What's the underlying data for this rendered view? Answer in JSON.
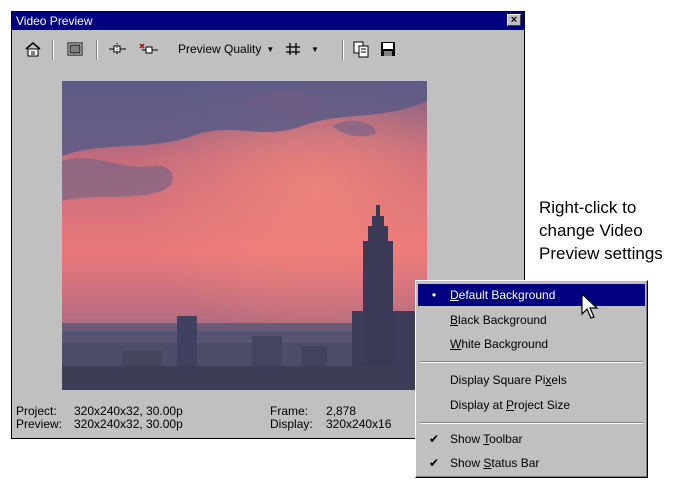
{
  "window": {
    "title": "Video Preview",
    "close_glyph": "×"
  },
  "toolbar": {
    "buttons": [
      {
        "icon": "properties-icon"
      },
      {
        "icon": "preview-window-icon"
      },
      {
        "icon": "split-screen-icon"
      },
      {
        "icon": "split-select-icon"
      }
    ],
    "preview_quality_label": "Preview Quality",
    "overlay_icon": "grid-hash-icon",
    "copy_icon": "copy-snapshot-icon",
    "save_icon": "save-snapshot-icon"
  },
  "status": {
    "project_label": "Project:",
    "project_value": "320x240x32, 30.00p",
    "preview_label": "Preview:",
    "preview_value": "320x240x32, 30.00p",
    "frame_label": "Frame:",
    "frame_value": "2,878",
    "display_label": "Display:",
    "display_value": "320x240x16"
  },
  "context_menu": {
    "items": [
      {
        "ul": "D",
        "rest": "efault Background",
        "mark": "•",
        "highlighted": true
      },
      {
        "ul": "B",
        "rest": "lack Background",
        "mark": ""
      },
      {
        "ul": "W",
        "rest": "hite Background",
        "mark": ""
      },
      {
        "pre": "Display Square Pi",
        "ul": "x",
        "rest": "els",
        "mark": ""
      },
      {
        "pre": "Display at ",
        "ul": "P",
        "rest": "roject Size",
        "mark": ""
      },
      {
        "pre": "Show ",
        "ul": "T",
        "rest": "oolbar",
        "mark": "✔"
      },
      {
        "pre": "Show ",
        "ul": "S",
        "rest": "tatus Bar",
        "mark": "✔"
      }
    ]
  },
  "callout": {
    "line1": "Right-click to",
    "line2": "change Video",
    "line3": "Preview settings"
  },
  "colors": {
    "titlebar": "#000080",
    "face": "#c0c0c0",
    "highlight": "#000080"
  }
}
